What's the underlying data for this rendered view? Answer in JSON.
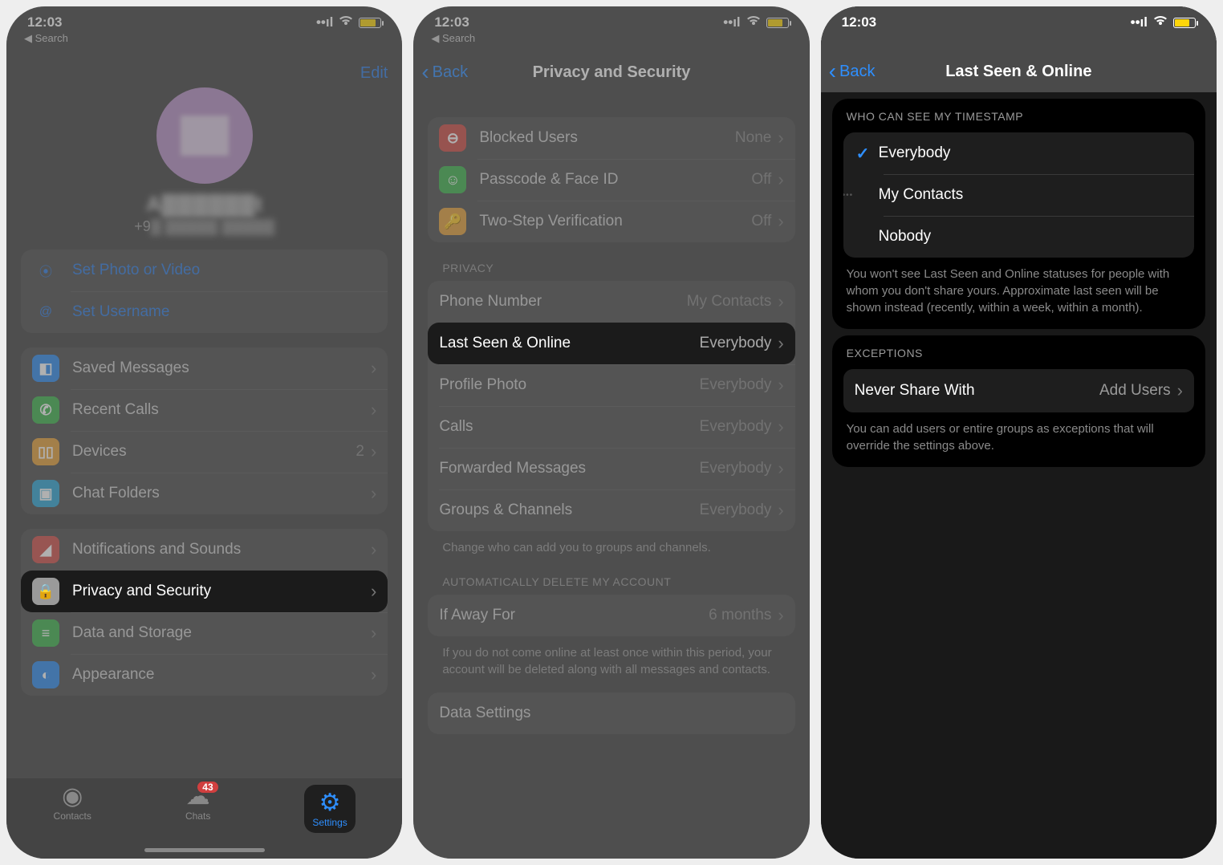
{
  "status": {
    "time": "12:03",
    "back": "Search"
  },
  "screen1": {
    "edit": "Edit",
    "set_photo": "Set Photo or Video",
    "set_username": "Set Username",
    "rows": {
      "saved": "Saved Messages",
      "recent": "Recent Calls",
      "devices": "Devices",
      "devices_val": "2",
      "folders": "Chat Folders",
      "notif": "Notifications and Sounds",
      "privacy": "Privacy and Security",
      "data": "Data and Storage",
      "appear": "Appearance"
    },
    "tabs": {
      "contacts": "Contacts",
      "chats": "Chats",
      "chats_badge": "43",
      "settings": "Settings"
    }
  },
  "screen2": {
    "back": "Back",
    "title": "Privacy and Security",
    "rows": {
      "blocked": "Blocked Users",
      "blocked_val": "None",
      "passcode": "Passcode & Face ID",
      "passcode_val": "Off",
      "twostep": "Two-Step Verification",
      "twostep_val": "Off"
    },
    "header_privacy": "PRIVACY",
    "privacy_rows": {
      "phone": "Phone Number",
      "phone_val": "My Contacts",
      "lastseen": "Last Seen & Online",
      "lastseen_val": "Everybody",
      "photo": "Profile Photo",
      "photo_val": "Everybody",
      "calls": "Calls",
      "calls_val": "Everybody",
      "fwd": "Forwarded Messages",
      "fwd_val": "Everybody",
      "groups": "Groups & Channels",
      "groups_val": "Everybody"
    },
    "groups_footer": "Change who can add you to groups and channels.",
    "header_auto": "AUTOMATICALLY DELETE MY ACCOUNT",
    "away": "If Away For",
    "away_val": "6 months",
    "away_footer": "If you do not come online at least once within this period, your account will be deleted along with all messages and contacts.",
    "data_settings": "Data Settings"
  },
  "screen3": {
    "back": "Back",
    "title": "Last Seen & Online",
    "header_who": "WHO CAN SEE MY TIMESTAMP",
    "options": {
      "everybody": "Everybody",
      "contacts": "My Contacts",
      "nobody": "Nobody"
    },
    "who_footer": "You won't see Last Seen and Online statuses for people with whom you don't share yours. Approximate last seen will be shown instead (recently, within a week, within a month).",
    "header_ex": "EXCEPTIONS",
    "never": "Never Share With",
    "never_val": "Add Users",
    "ex_footer": "You can add users or entire groups as exceptions that will override the settings above."
  }
}
